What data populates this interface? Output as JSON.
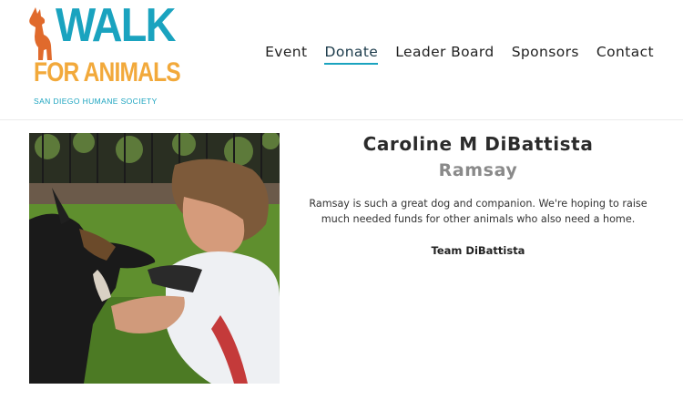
{
  "brand": {
    "logo_line1": "WALK",
    "logo_line2": "FOR ANIMALS",
    "logo_line3": "SAN DIEGO HUMANE SOCIETY",
    "walk_color": "#1aa3bf",
    "for_color": "#f2a93b"
  },
  "nav": {
    "items": [
      {
        "label": "Event",
        "active": false
      },
      {
        "label": "Donate",
        "active": true
      },
      {
        "label": "Leader Board",
        "active": false
      },
      {
        "label": "Sponsors",
        "active": false
      },
      {
        "label": "Contact",
        "active": false
      }
    ]
  },
  "participant": {
    "name": "Caroline M DiBattista",
    "pet_name": "Ramsay",
    "story": "Ramsay is such a great dog and companion. We're hoping to raise much needed funds for other animals who also need a home.",
    "team": "Team DiBattista"
  }
}
